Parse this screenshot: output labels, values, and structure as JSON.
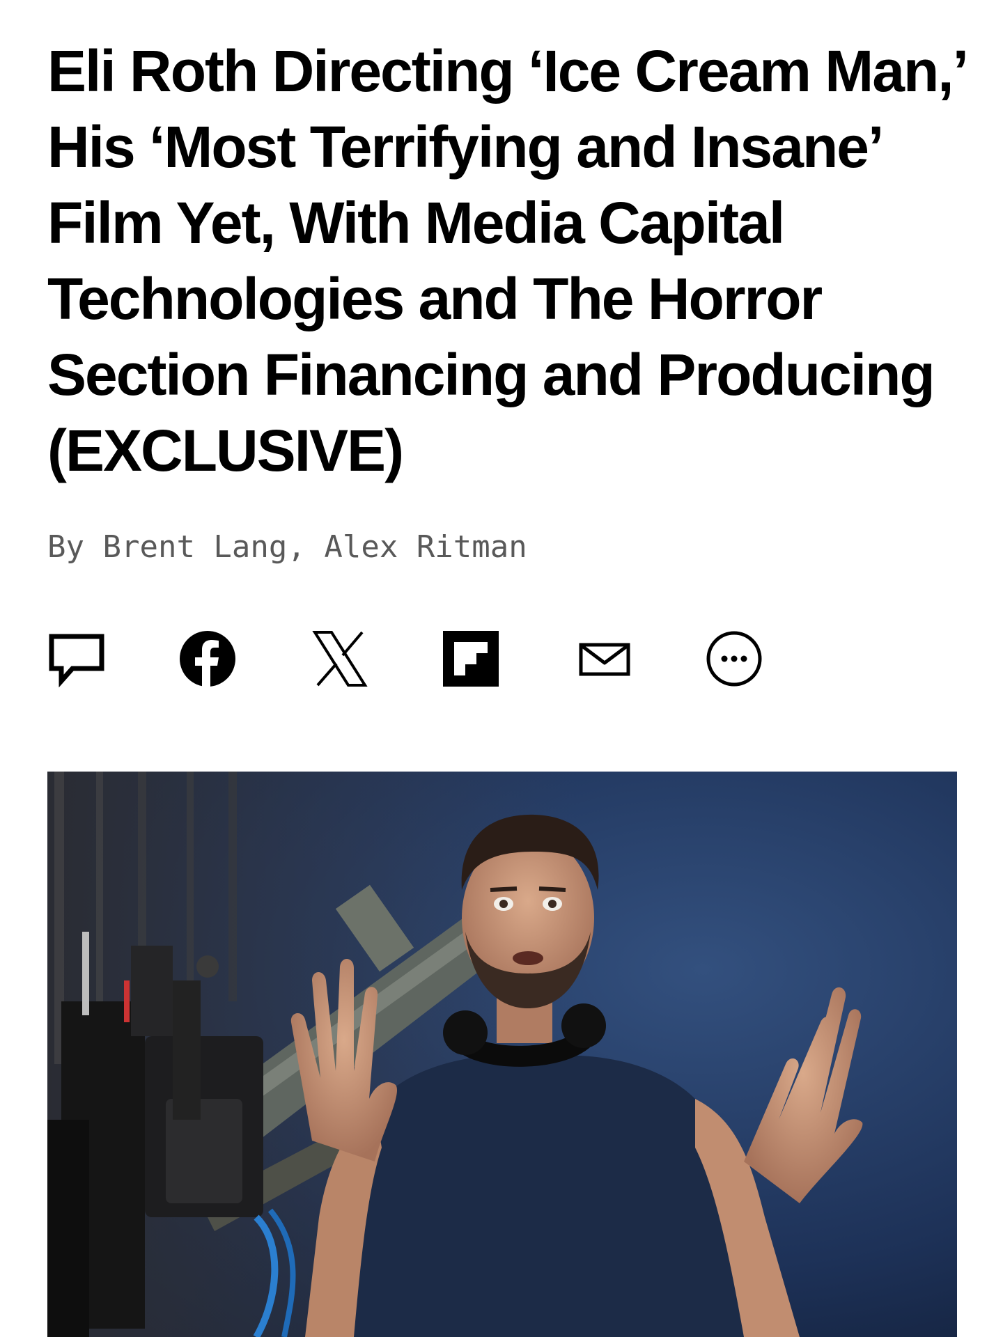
{
  "article": {
    "headline": "Eli Roth Directing ‘Ice Cream Man,’ His ‘Most Terrifying and Insane’ Film Yet, With Media Capital Technologies and The Horror Section Financing and Producing (EXCLUSIVE)",
    "byline_prefix": "By ",
    "authors": "Brent Lang, Alex Ritman"
  },
  "share_bar": {
    "icons": [
      "comment-icon",
      "facebook-icon",
      "x-icon",
      "flipboard-icon",
      "email-icon",
      "more-icon"
    ]
  },
  "hero_image": {
    "subject": "photo-of-director-on-film-set"
  },
  "colors": {
    "text": "#000000",
    "byline": "#595959",
    "hero_background": "#243a63"
  }
}
